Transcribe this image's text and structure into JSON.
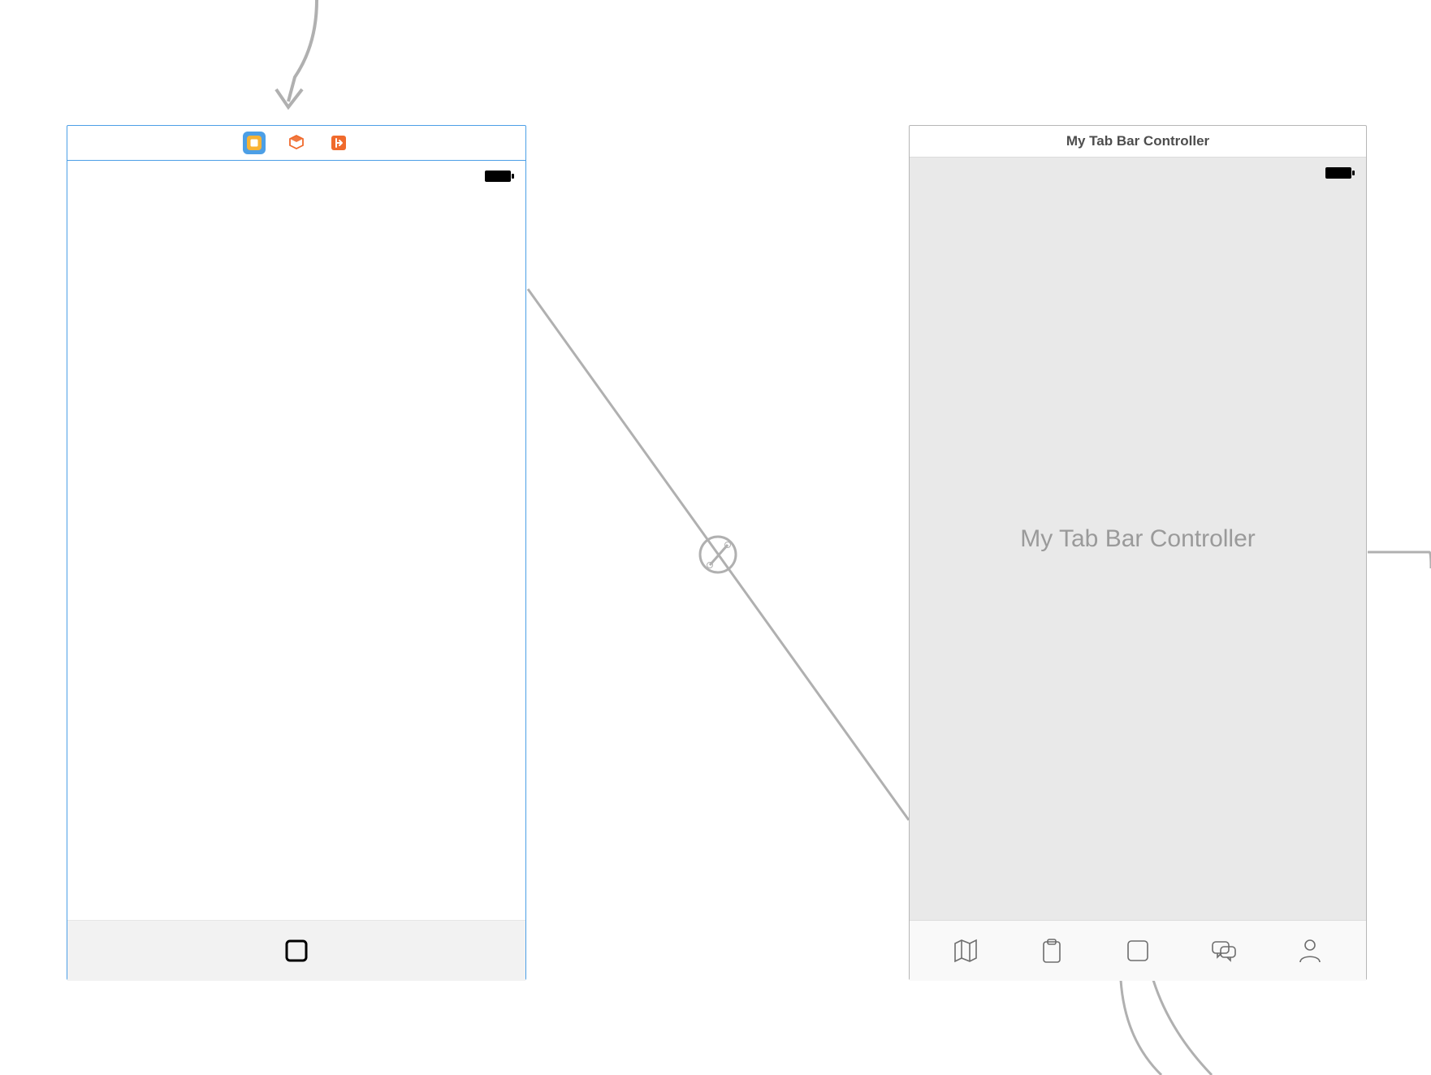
{
  "left_scene": {
    "titlebar_icons": {
      "view_controller": "view-controller-icon",
      "first_responder": "first-responder-icon",
      "exit": "exit-icon"
    },
    "tab_items": [
      "square"
    ]
  },
  "right_scene": {
    "title": "My Tab Bar Controller",
    "placeholder": "My Tab Bar Controller",
    "tab_items": [
      "map",
      "clipboard",
      "square",
      "chat",
      "person"
    ]
  },
  "connectors": {
    "entry_arrow": true,
    "segue_kind": "relationship"
  }
}
